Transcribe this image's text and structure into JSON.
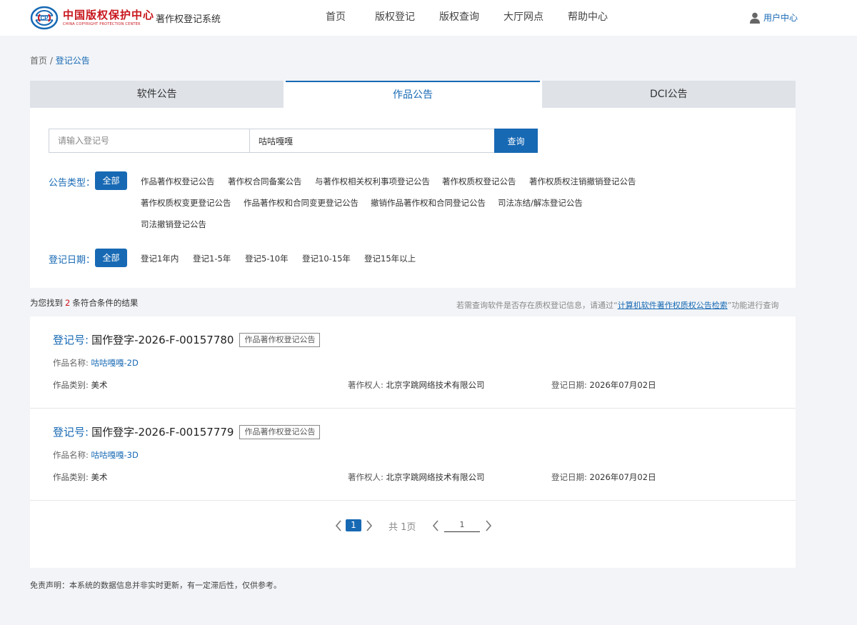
{
  "header": {
    "logo_cn": "中国版权保护中心",
    "logo_en": "CHINA COPYRIGHT PROTECTION CENTER",
    "system_title": "著作权登记系统",
    "nav": [
      "首页",
      "版权登记",
      "版权查询",
      "大厅网点",
      "帮助中心"
    ],
    "user_center": "用户中心"
  },
  "breadcrumb": {
    "home": "首页",
    "separator": "/",
    "current": "登记公告"
  },
  "tabs": [
    "软件公告",
    "作品公告",
    "DCI公告"
  ],
  "active_tab": "作品公告",
  "search": {
    "reg_placeholder": "请输入登记号",
    "name_value": "咕咕嘎嘎",
    "button": "查询"
  },
  "filters": {
    "type_label": "公告类型：",
    "all": "全部",
    "types": [
      "作品著作权登记公告",
      "著作权合同备案公告",
      "与著作权相关权利事项登记公告",
      "著作权质权登记公告",
      "著作权质权注销撤销登记公告",
      "著作权质权变更登记公告",
      "作品著作权和合同变更登记公告",
      "撤销作品著作权和合同登记公告",
      "司法冻结/解冻登记公告",
      "司法撤销登记公告"
    ],
    "date_label": "登记日期：",
    "dates": [
      "登记1年内",
      "登记1-5年",
      "登记5-10年",
      "登记10-15年",
      "登记15年以上"
    ]
  },
  "results": {
    "prefix": "为您找到",
    "count": "2",
    "suffix": "条符合条件的结果",
    "hint_pre": "若需查询软件是否存在质权登记信息，请通过“",
    "hint_link": "计算机软件著作权质权公告检索",
    "hint_post": "”功能进行查询",
    "items": [
      {
        "reg_key": "登记号:",
        "reg_no": "国作登字-2026-F-00157780",
        "tag": "作品著作权登记公告",
        "name_key": "作品名称:",
        "name": "咕咕嘎嘎-2D",
        "category_key": "作品类别:",
        "category": "美术",
        "owner_key": "著作权人:",
        "owner": "北京字跳网络技术有限公司",
        "date_key": "登记日期:",
        "date": "2026年07月02日"
      },
      {
        "reg_key": "登记号:",
        "reg_no": "国作登字-2026-F-00157779",
        "tag": "作品著作权登记公告",
        "name_key": "作品名称:",
        "name": "咕咕嘎嘎-3D",
        "category_key": "作品类别:",
        "category": "美术",
        "owner_key": "著作权人:",
        "owner": "北京字跳网络技术有限公司",
        "date_key": "登记日期:",
        "date": "2026年07月02日"
      }
    ]
  },
  "pagination": {
    "current": "1",
    "total": "共 1页",
    "jump_value": "1"
  },
  "disclaimer": "免责声明：本系统的数据信息并非实时更新，有一定滞后性，仅供参考。",
  "colors": {
    "primary": "#1769b4",
    "brand_red": "#c8161d",
    "count_red": "#d0121b",
    "page_bg": "#f2f4f7"
  }
}
